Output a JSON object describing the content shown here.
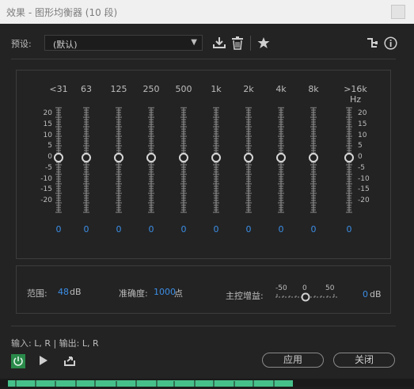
{
  "window": {
    "title": "效果 - 图形均衡器 (10 段)"
  },
  "preset": {
    "label": "预设:",
    "value": "(默认)"
  },
  "eq": {
    "bands": [
      {
        "freq": "<31",
        "value": "0"
      },
      {
        "freq": "63",
        "value": "0"
      },
      {
        "freq": "125",
        "value": "0"
      },
      {
        "freq": "250",
        "value": "0"
      },
      {
        "freq": "500",
        "value": "0"
      },
      {
        "freq": "1k",
        "value": "0"
      },
      {
        "freq": "2k",
        "value": "0"
      },
      {
        "freq": "4k",
        "value": "0"
      },
      {
        "freq": "8k",
        "value": "0"
      },
      {
        "freq": ">16k Hz",
        "value": "0"
      }
    ],
    "scale": [
      "20",
      "15",
      "10",
      "5",
      "0",
      "-5",
      "-10",
      "-15",
      "-20"
    ]
  },
  "controls": {
    "range_label": "范围:",
    "range_value": "48",
    "range_unit": "dB",
    "accuracy_label": "准确度:",
    "accuracy_value": "1000",
    "accuracy_unit": "点",
    "master_label": "主控增益:",
    "master_scale": [
      "-50",
      "0",
      "50"
    ],
    "master_value": "0",
    "master_unit": "dB"
  },
  "io": {
    "text": "输入: L, R | 输出: L, R"
  },
  "buttons": {
    "apply": "应用",
    "close": "关闭"
  },
  "colors": {
    "accent": "#3b8ee6",
    "power": "#2a8a4a",
    "waveform": "#46c08a"
  },
  "icons": [
    "save-preset-icon",
    "delete-preset-icon",
    "favorite-star-icon",
    "routing-icon",
    "info-icon",
    "power-icon",
    "play-icon",
    "export-icon"
  ]
}
